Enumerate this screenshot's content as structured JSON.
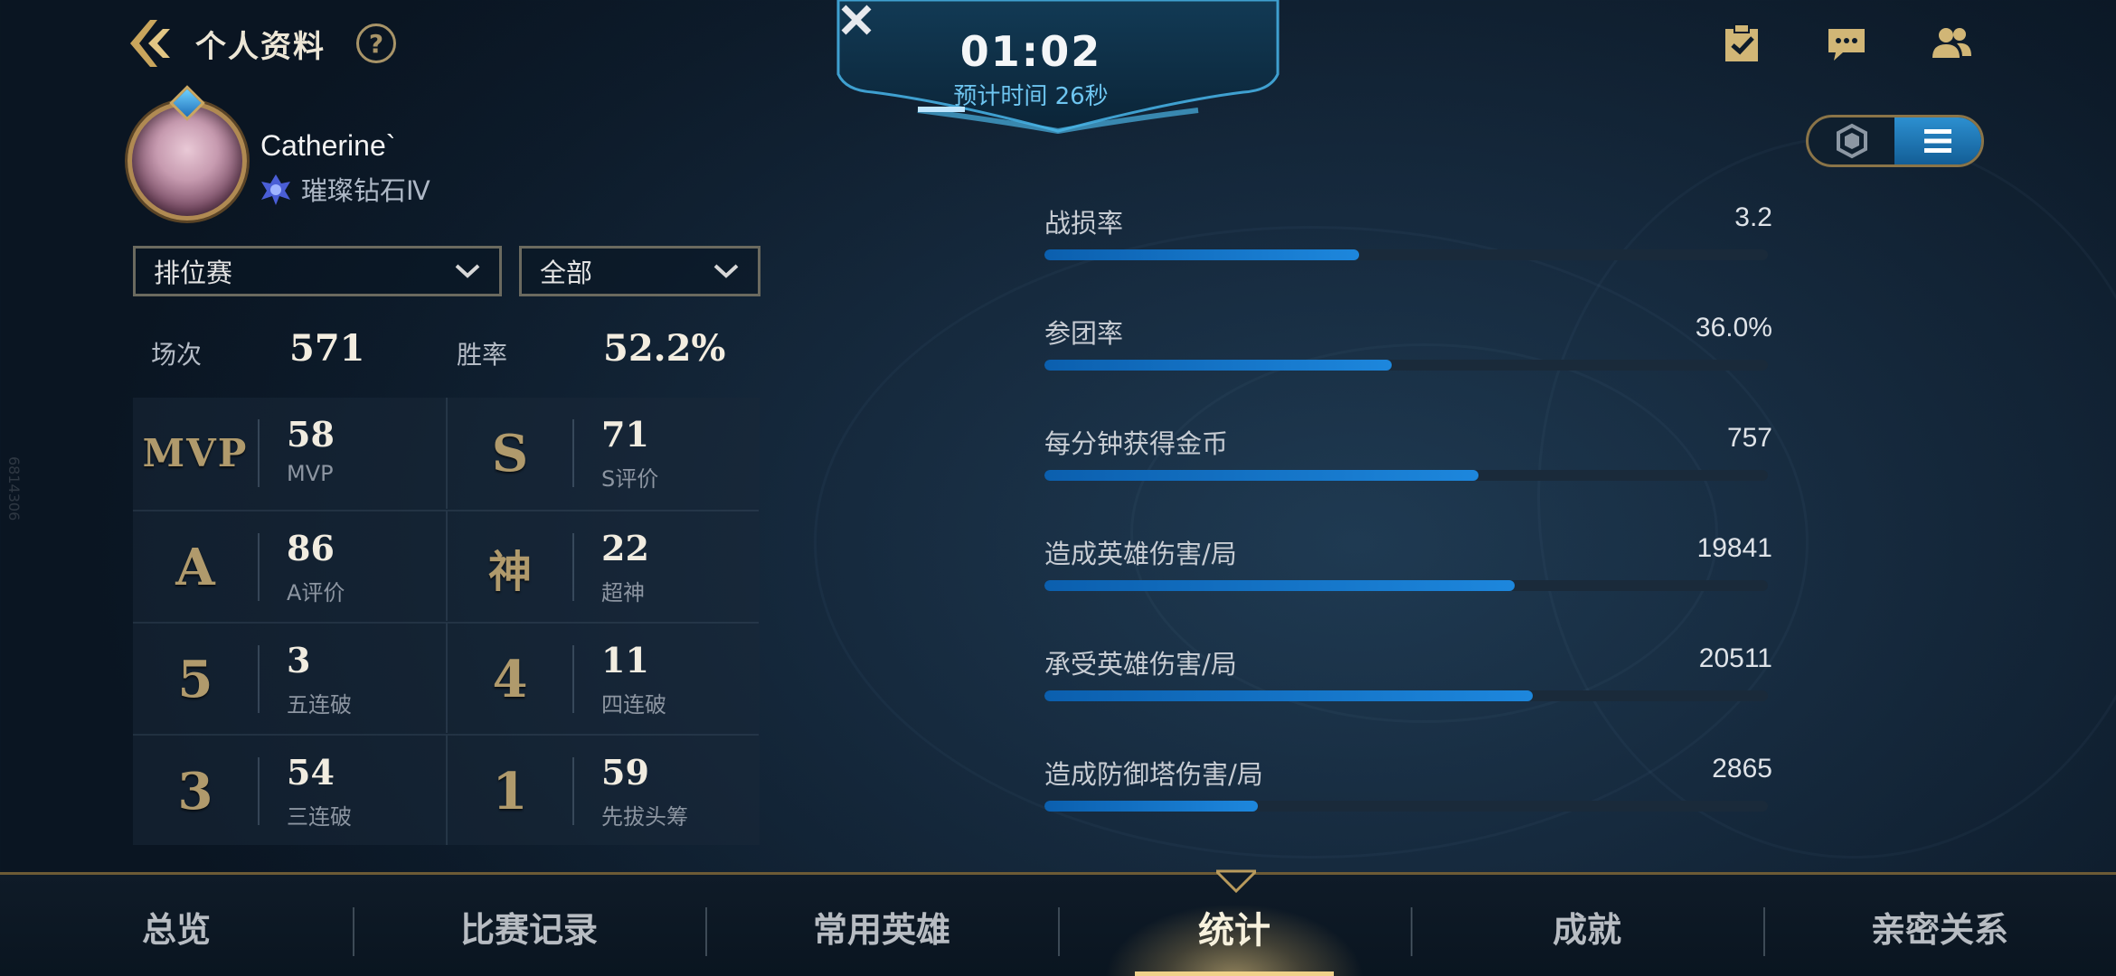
{
  "header": {
    "title": "个人资料"
  },
  "watermark": "6814306",
  "profile": {
    "name": "Catherine`",
    "rank": "璀璨钻石Ⅳ"
  },
  "filters": {
    "mode": "排位赛",
    "scope": "全部"
  },
  "summary": {
    "games_label": "场次",
    "games_value": "571",
    "winrate_label": "胜率",
    "winrate_value": "52.2%"
  },
  "grid": [
    {
      "badge": "MVP",
      "value": "58",
      "label": "MVP"
    },
    {
      "badge": "S",
      "value": "71",
      "label": "S评价"
    },
    {
      "badge": "A",
      "value": "86",
      "label": "A评价"
    },
    {
      "badge": "神",
      "value": "22",
      "label": "超神"
    },
    {
      "badge": "5",
      "value": "3",
      "label": "五连破"
    },
    {
      "badge": "4",
      "value": "11",
      "label": "四连破"
    },
    {
      "badge": "3",
      "value": "54",
      "label": "三连破"
    },
    {
      "badge": "1",
      "value": "59",
      "label": "先拔头筹"
    }
  ],
  "timer": {
    "time": "01:02",
    "estimate": "预计时间 26秒"
  },
  "stats": [
    {
      "label": "战损率",
      "value": "3.2",
      "fill": 0.435
    },
    {
      "label": "参团率",
      "value": "36.0%",
      "fill": 0.48
    },
    {
      "label": "每分钟获得金币",
      "value": "757",
      "fill": 0.6
    },
    {
      "label": "造成英雄伤害/局",
      "value": "19841",
      "fill": 0.65
    },
    {
      "label": "承受英雄伤害/局",
      "value": "20511",
      "fill": 0.675
    },
    {
      "label": "造成防御塔伤害/局",
      "value": "2865",
      "fill": 0.295
    }
  ],
  "nav": [
    {
      "label": "总览",
      "active": false
    },
    {
      "label": "比赛记录",
      "active": false
    },
    {
      "label": "常用英雄",
      "active": false
    },
    {
      "label": "统计",
      "active": true
    },
    {
      "label": "成就",
      "active": false
    },
    {
      "label": "亲密关系",
      "active": false
    }
  ],
  "colors": {
    "accent_blue": "#1d87dd",
    "gold": "#b09a6c",
    "active_tab": "#f7f1dd"
  }
}
